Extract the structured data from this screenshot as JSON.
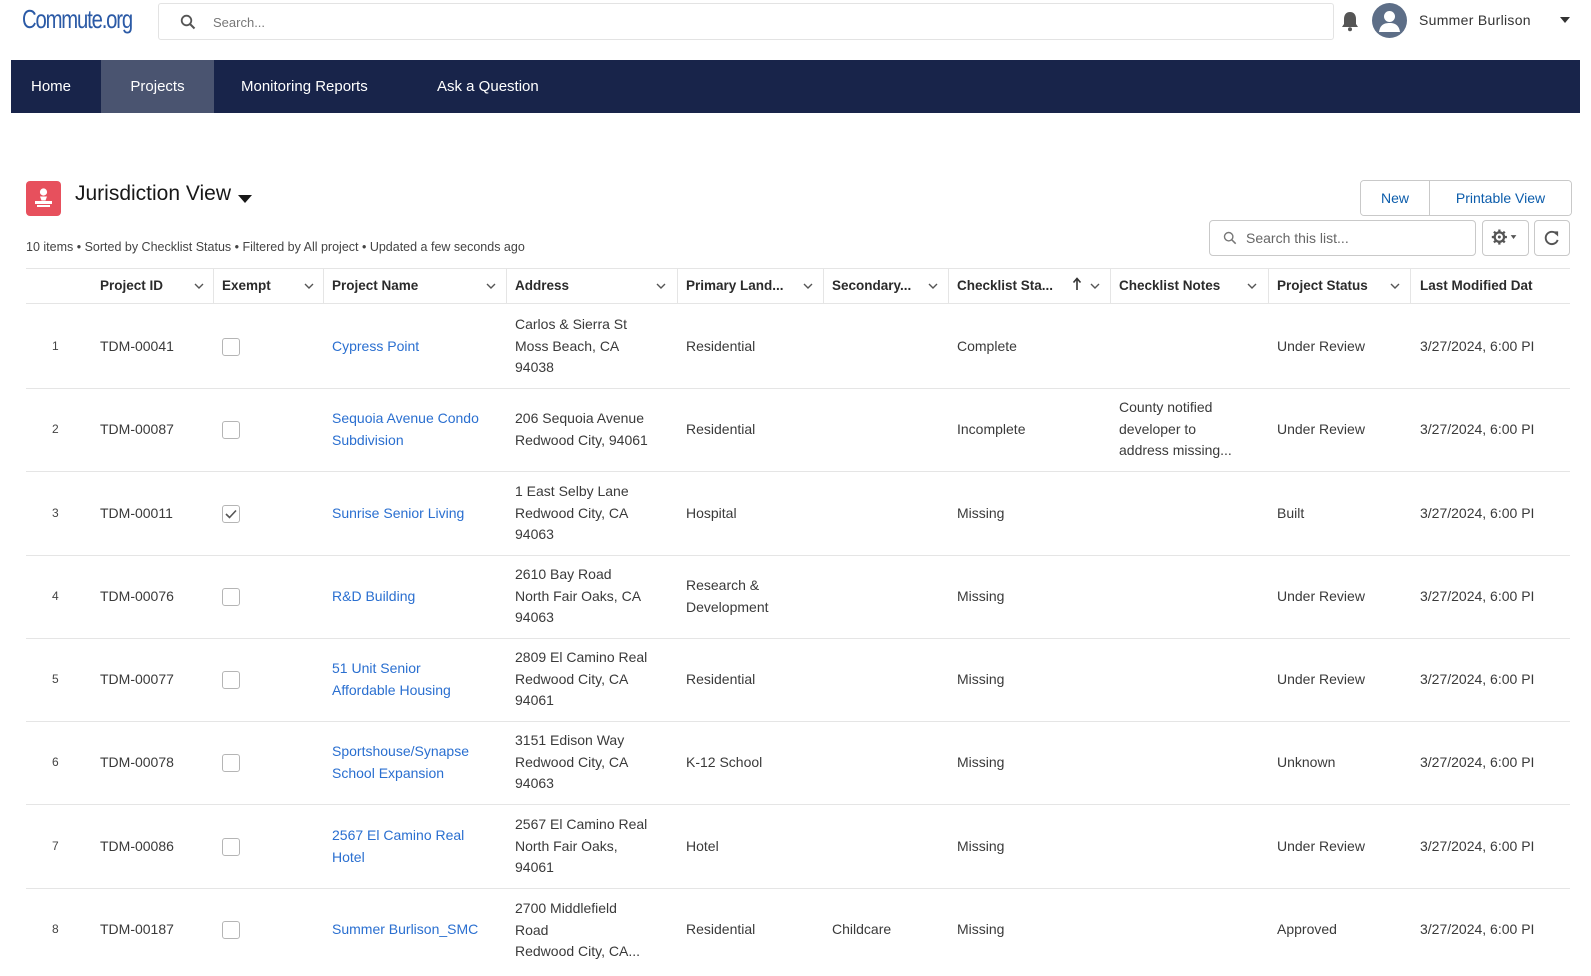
{
  "header": {
    "logo": "Commute.org",
    "search_placeholder": "Search...",
    "user_name": "Summer Burlison"
  },
  "nav": [
    "Home",
    "Projects",
    "Monitoring Reports",
    "Ask a Question"
  ],
  "nav_active": "Projects",
  "list": {
    "title": "Jurisdiction View",
    "meta": "10 items • Sorted by Checklist Status • Filtered by All project • Updated a few seconds ago",
    "new_label": "New",
    "printable_label": "Printable View",
    "search_placeholder": "Search this list..."
  },
  "columns": [
    "Project ID",
    "Exempt",
    "Project Name",
    "Address",
    "Primary Land...",
    "Secondary...",
    "Checklist Sta...",
    "Checklist Notes",
    "Project Status",
    "Last Modified Dat"
  ],
  "sorted_column": "Checklist Sta...",
  "rows": [
    {
      "num": "1",
      "id": "TDM-00041",
      "exempt": false,
      "name": "Cypress Point",
      "address": "Carlos & Sierra St\nMoss Beach, CA\n94038",
      "primary": "Residential",
      "secondary": "",
      "checklist": "Complete",
      "notes": "",
      "status": "Under Review",
      "modified": "3/27/2024, 6:00 PI"
    },
    {
      "num": "2",
      "id": "TDM-00087",
      "exempt": false,
      "name": "Sequoia Avenue Condo\nSubdivision",
      "address": "206 Sequoia Avenue\nRedwood City, 94061",
      "primary": "Residential",
      "secondary": "",
      "checklist": "Incomplete",
      "notes": "County notified\ndeveloper to\naddress missing...",
      "status": "Under Review",
      "modified": "3/27/2024, 6:00 PI"
    },
    {
      "num": "3",
      "id": "TDM-00011",
      "exempt": true,
      "name": "Sunrise Senior Living",
      "address": "1 East Selby Lane\nRedwood City, CA\n94063",
      "primary": "Hospital",
      "secondary": "",
      "checklist": "Missing",
      "notes": "",
      "status": "Built",
      "modified": "3/27/2024, 6:00 PI"
    },
    {
      "num": "4",
      "id": "TDM-00076",
      "exempt": false,
      "name": "R&D Building",
      "address": "2610 Bay Road\nNorth Fair Oaks, CA\n94063",
      "primary": "Research &\nDevelopment",
      "secondary": "",
      "checklist": "Missing",
      "notes": "",
      "status": "Under Review",
      "modified": "3/27/2024, 6:00 PI"
    },
    {
      "num": "5",
      "id": "TDM-00077",
      "exempt": false,
      "name": "51 Unit Senior\nAffordable Housing",
      "address": "2809 El Camino Real\nRedwood City, CA\n94061",
      "primary": "Residential",
      "secondary": "",
      "checklist": "Missing",
      "notes": "",
      "status": "Under Review",
      "modified": "3/27/2024, 6:00 PI"
    },
    {
      "num": "6",
      "id": "TDM-00078",
      "exempt": false,
      "name": "Sportshouse/Synapse\nSchool Expansion",
      "address": "3151 Edison Way\nRedwood City, CA\n94063",
      "primary": "K-12 School",
      "secondary": "",
      "checklist": "Missing",
      "notes": "",
      "status": "Unknown",
      "modified": "3/27/2024, 6:00 PI"
    },
    {
      "num": "7",
      "id": "TDM-00086",
      "exempt": false,
      "name": "2567 El Camino Real\nHotel",
      "address": "2567 El Camino Real\nNorth Fair Oaks,\n94061",
      "primary": "Hotel",
      "secondary": "",
      "checklist": "Missing",
      "notes": "",
      "status": "Under Review",
      "modified": "3/27/2024, 6:00 PI"
    },
    {
      "num": "8",
      "id": "TDM-00187",
      "exempt": false,
      "name": "Summer Burlison_SMC",
      "address": "2700 Middlefield\nRoad\nRedwood City, CA...",
      "primary": "Residential",
      "secondary": "Childcare",
      "checklist": "Missing",
      "notes": "",
      "status": "Approved",
      "modified": "3/27/2024, 6:00 PI"
    }
  ],
  "colors": {
    "nav_bg": "#18244a",
    "nav_active": "#4a5470",
    "link": "#2a6fd0",
    "brand": "#2b5aa6",
    "list_icon": "#e7505d"
  },
  "icons": [
    "search-icon",
    "bell-icon",
    "user-avatar-icon",
    "list-view-icon",
    "gear-icon",
    "refresh-icon",
    "chevron-down-icon",
    "sort-up-icon",
    "checkmark-icon"
  ]
}
